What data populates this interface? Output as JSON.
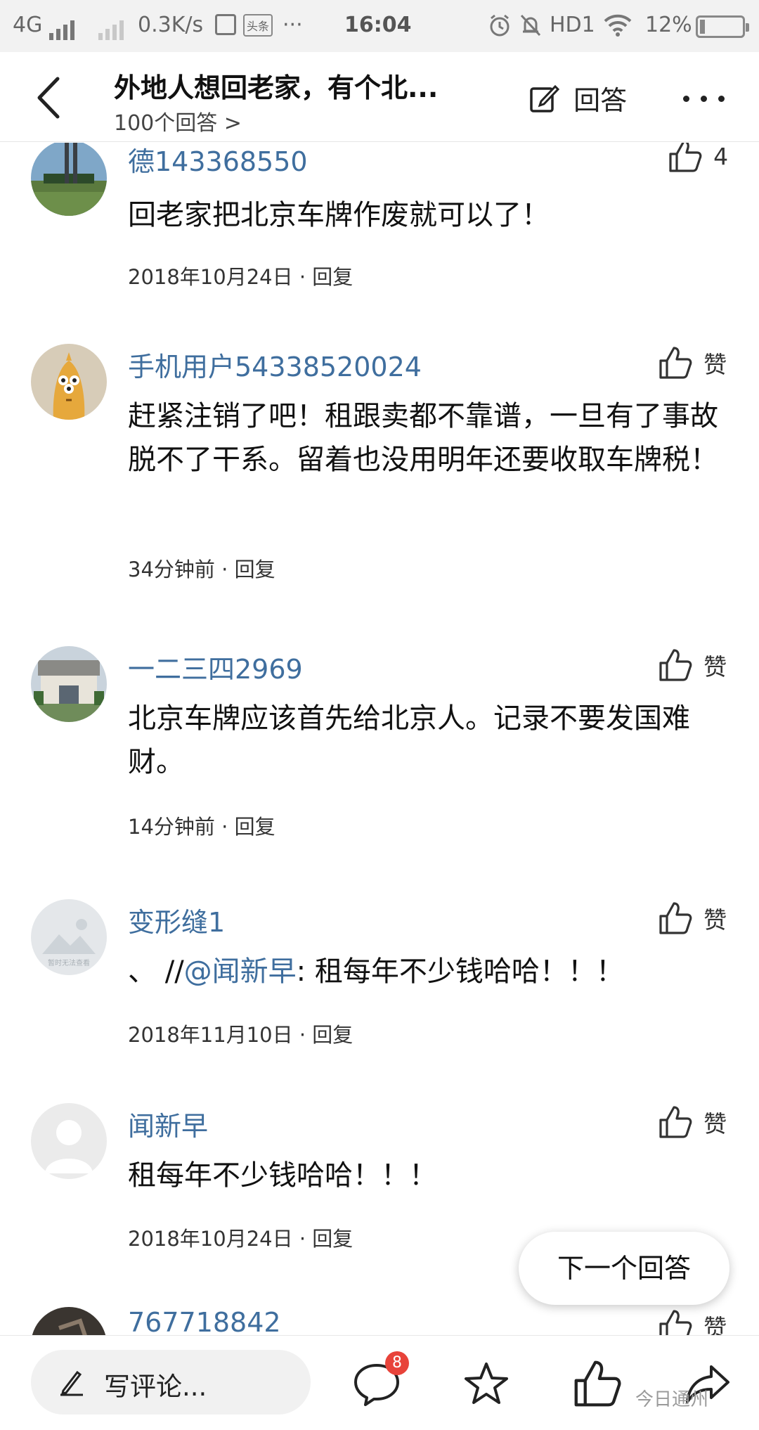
{
  "status_bar": {
    "network": "4G",
    "speed": "0.3K/s",
    "time": "16:04",
    "hd_label": "HD1",
    "battery_percent": "12%",
    "battery_level": 0.12,
    "dots": "···",
    "app_badge": "头条"
  },
  "header": {
    "title": "外地人想回老家，有个北...",
    "subtitle": "100个回答 >",
    "answer_label": "回答",
    "icons": {
      "back": "chevron-left-icon",
      "answer": "edit-icon",
      "more": "more-icon"
    }
  },
  "comments": [
    {
      "user": "德143368550",
      "text": "回老家把北京车牌作废就可以了！",
      "time": "2018年10月24日",
      "reply": "回复",
      "like_label": "4"
    },
    {
      "user": "手机用户54338520024",
      "text": "赶紧注销了吧！租跟卖都不靠谱，一旦有了事故脱不了干系。留着也没用明年还要收取车牌税！",
      "time": "34分钟前",
      "reply": "回复",
      "like_label": "赞"
    },
    {
      "user": "一二三四2969",
      "text": "北京车牌应该首先给北京人。记录不要发国难财。",
      "time": "14分钟前",
      "reply": "回复",
      "like_label": "赞"
    },
    {
      "user": "变形缝1",
      "text_prefix": "、 //",
      "mention": "@闻新早",
      "text_suffix": ": 租每年不少钱哈哈！！！",
      "time": "2018年11月10日",
      "reply": "回复",
      "like_label": "赞",
      "avatar_caption": "暂时无法查看"
    },
    {
      "user": "闻新早",
      "text": "租每年不少钱哈哈！！！",
      "time": "2018年10月24日",
      "reply": "回复",
      "like_label": "赞"
    },
    {
      "user": "767718842",
      "like_label": "赞"
    }
  ],
  "meta_separator": " · ",
  "next_answer_label": "下一个回答",
  "bottom_bar": {
    "compose_placeholder": "写评论...",
    "comment_count_badge": "8",
    "watermark": "今日通州",
    "icons": [
      "pen-icon",
      "comment-icon",
      "star-icon",
      "thumbs-up-icon",
      "share-icon"
    ]
  },
  "colors": {
    "link_blue": "#3f6e9e",
    "badge_red": "#e8433a",
    "status_bar_bg": "#f2f2f2"
  }
}
